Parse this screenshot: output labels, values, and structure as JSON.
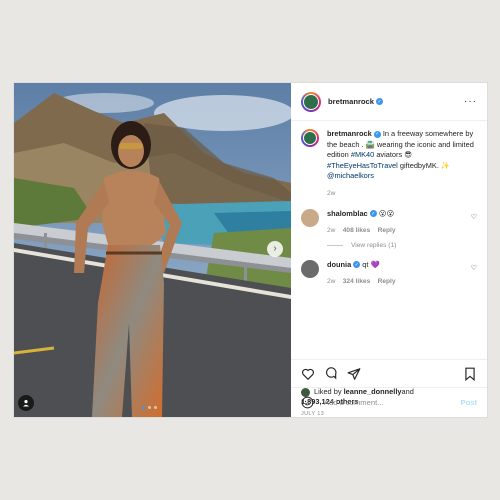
{
  "post": {
    "author": "bretmanrock",
    "more_icon": "ellipsis-icon",
    "caption": {
      "username": "bretmanrock",
      "text_1": "In a freeway somewhere by the beach . 🛣️ wearing the iconic and limited edition ",
      "hashtag_1": "#MK40",
      "text_2": " aviators 😎 ",
      "hashtag_2": "#TheEyeHasToTravel",
      "text_3": " giftedbyMK. ✨ ",
      "mention": "@michaelkors",
      "time": "2w"
    },
    "comments": [
      {
        "username": "shalomblac",
        "text": "😮😮",
        "time": "2w",
        "likes": "408 likes",
        "reply": "Reply",
        "avatar_color": "#c8a98a"
      },
      {
        "username": "dounia",
        "text": "qt 💜",
        "time": "2w",
        "likes": "324 likes",
        "reply": "Reply",
        "avatar_color": "#6b6b6b"
      }
    ],
    "view_replies": "View replies (1)",
    "liked_by_prefix": "Liked by ",
    "liked_by_user": "leanne_donnelly",
    "liked_by_and": " and",
    "liked_by_others": "1,893,124 others",
    "date": "JULY 13",
    "add_comment_placeholder": "Add a comment...",
    "post_button": "Post"
  },
  "colors": {
    "accent": "#3897f0",
    "link": "#00376b",
    "muted": "#8e8e8e"
  }
}
